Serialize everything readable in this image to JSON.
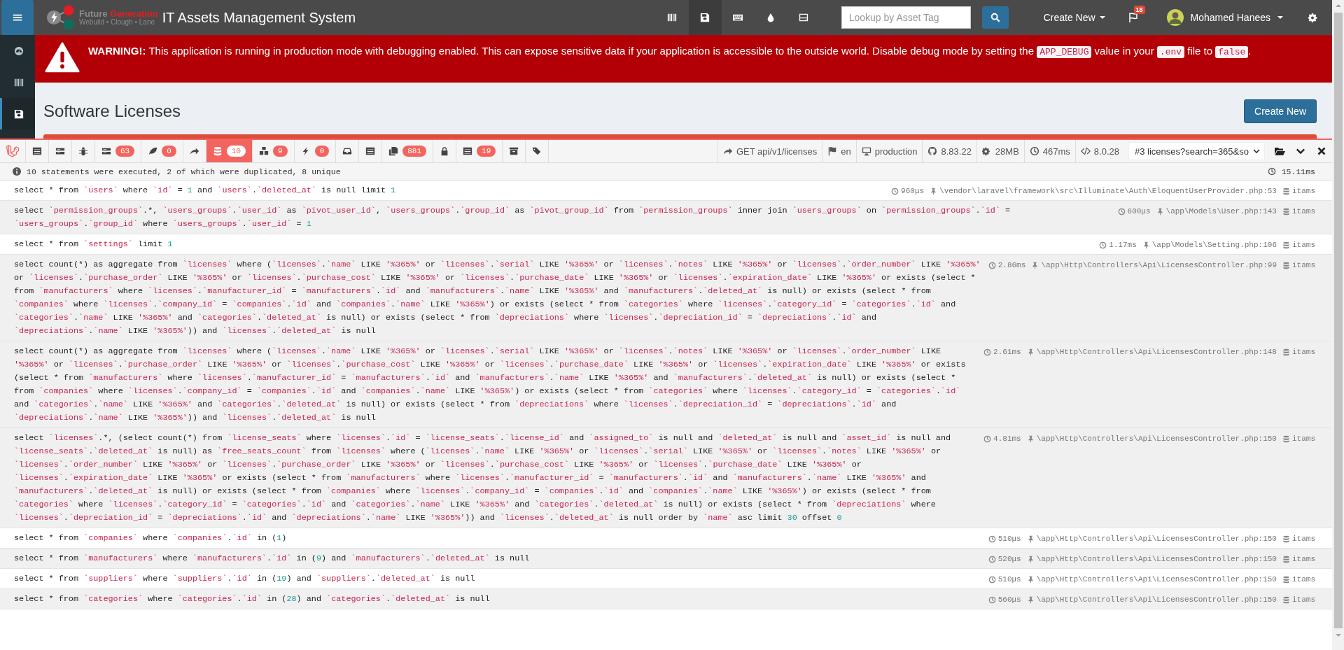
{
  "nav": {
    "logo": {
      "word_1": "Future",
      "word_2": "Generation",
      "tagline": "Webuild • Clough • Lane"
    },
    "title": "IT Assets Management System",
    "icons": [
      {
        "kind": "barcode",
        "selected": false
      },
      {
        "kind": "save",
        "selected": true
      },
      {
        "kind": "keyboard",
        "selected": false
      },
      {
        "kind": "drop",
        "selected": false
      },
      {
        "kind": "drive",
        "selected": false
      }
    ],
    "search": {
      "placeholder": "Lookup by Asset Tag"
    },
    "create_menu": "Create New",
    "flag_badge": "18",
    "user": "Mohamed Hanees"
  },
  "sidebar": {
    "items": [
      {
        "kind": "dashboard",
        "selected": false
      },
      {
        "kind": "barcode",
        "selected": false
      },
      {
        "kind": "save",
        "selected": true
      }
    ]
  },
  "warning": {
    "segments": [
      {
        "kind": "text",
        "text": "**WARNING!:** This application is running in production mode with debugging enabled. This can expose sensitive data if your application is accessible to the outside world. Disable debug mode by setting the "
      },
      {
        "kind": "code",
        "text": "APP_DEBUG"
      },
      {
        "kind": "text",
        "text": " value in your "
      },
      {
        "kind": "code",
        "text": ".env"
      },
      {
        "kind": "text",
        "text": " file to "
      },
      {
        "kind": "code",
        "text": "false"
      },
      {
        "kind": "text",
        "text": "."
      }
    ]
  },
  "page": {
    "title": "Software Licenses",
    "create_button": "Create New"
  },
  "debugbar": {
    "tabs": [
      {
        "kind": "list",
        "selected": false
      },
      {
        "kind": "bars",
        "selected": false
      },
      {
        "kind": "bug",
        "selected": false
      },
      {
        "kind": "bars",
        "badge": "63",
        "selected": false
      },
      {
        "kind": "leaf",
        "badge": "0",
        "selected": false
      },
      {
        "kind": "arrow",
        "selected": false
      },
      {
        "kind": "database",
        "badge": "10",
        "selected": true
      },
      {
        "kind": "cubes",
        "badge": "9",
        "selected": false
      },
      {
        "kind": "bolt",
        "badge": "0",
        "selected": false
      },
      {
        "kind": "inbox",
        "selected": false
      },
      {
        "kind": "list",
        "selected": false
      },
      {
        "kind": "pages",
        "badge": "881",
        "selected": false
      },
      {
        "kind": "lock",
        "selected": false
      },
      {
        "kind": "list",
        "badge": "19",
        "selected": false
      },
      {
        "kind": "archive",
        "selected": false
      },
      {
        "kind": "tags",
        "selected": false
      }
    ],
    "meta": [
      {
        "kind": "arrow",
        "text": "GET api/v1/licenses"
      },
      {
        "kind": "flag",
        "text": "en"
      },
      {
        "kind": "monitor",
        "text": "production"
      },
      {
        "kind": "github",
        "text": "8.83.22"
      },
      {
        "kind": "gears",
        "text": "28MB"
      },
      {
        "kind": "clock",
        "text": "467ms"
      },
      {
        "kind": "code",
        "text": "8.0.28"
      }
    ],
    "dataset": "#3 licenses?search=365&so",
    "summary": "10 statements were executed, 2 of which were duplicated, 8 unique",
    "total_time": "15.11ms",
    "statements": [
      {
        "sql": "select * from `users` where `id` = 1 and `users`.`deleted_at` is null limit 1",
        "duration": "960μs",
        "source": "\\vendor\\laravel\\framework\\src\\Illuminate\\Auth\\EloquentUserProvider.php:53",
        "connection": "itams",
        "highlighted": false
      },
      {
        "sql": "select `permission_groups`.*, `users_groups`.`user_id` as `pivot_user_id`, `users_groups`.`group_id` as `pivot_group_id` from `permission_groups` inner join `users_groups` on `permission_groups`.`id` = `users_groups`.`group_id` where `users_groups`.`user_id` = 1",
        "duration": "600μs",
        "source": "\\app\\Models\\User.php:143",
        "connection": "itams",
        "highlighted": true
      },
      {
        "sql": "select * from `settings` limit 1",
        "duration": "1.17ms",
        "source": "\\app\\Models\\Setting.php:106",
        "connection": "itams",
        "highlighted": false
      },
      {
        "sql": "select count(*) as aggregate from `licenses` where (`licenses`.`name` LIKE '%365%' or `licenses`.`serial` LIKE '%365%' or `licenses`.`notes` LIKE '%365%' or `licenses`.`order_number` LIKE '%365%' or `licenses`.`purchase_order` LIKE '%365%' or `licenses`.`purchase_cost` LIKE '%365%' or `licenses`.`purchase_date` LIKE '%365%' or `licenses`.`expiration_date` LIKE '%365%' or exists (select * from `manufacturers` where `licenses`.`manufacturer_id` = `manufacturers`.`id` and `manufacturers`.`name` LIKE '%365%' and `manufacturers`.`deleted_at` is null) or exists (select * from `companies` where `licenses`.`company_id` = `companies`.`id` and `companies`.`name` LIKE '%365%') or exists (select * from `categories` where `licenses`.`category_id` = `categories`.`id` and `categories`.`name` LIKE '%365%' and `categories`.`deleted_at` is null) or exists (select * from `depreciations` where `licenses`.`depreciation_id` = `depreciations`.`id` and `depreciations`.`name` LIKE '%365%')) and `licenses`.`deleted_at` is null",
        "duration": "2.86ms",
        "source": "\\app\\Http\\Controllers\\Api\\LicensesController.php:99",
        "connection": "itams",
        "highlighted": true
      },
      {
        "sql": "select count(*) as aggregate from `licenses` where (`licenses`.`name` LIKE '%365%' or `licenses`.`serial` LIKE '%365%' or `licenses`.`notes` LIKE '%365%' or `licenses`.`order_number` LIKE '%365%' or `licenses`.`purchase_order` LIKE '%365%' or `licenses`.`purchase_cost` LIKE '%365%' or `licenses`.`purchase_date` LIKE '%365%' or `licenses`.`expiration_date` LIKE '%365%' or exists (select * from `manufacturers` where `licenses`.`manufacturer_id` = `manufacturers`.`id` and `manufacturers`.`name` LIKE '%365%' and `manufacturers`.`deleted_at` is null) or exists (select * from `companies` where `licenses`.`company_id` = `companies`.`id` and `companies`.`name` LIKE '%365%') or exists (select * from `categories` where `licenses`.`category_id` = `categories`.`id` and `categories`.`name` LIKE '%365%' and `categories`.`deleted_at` is null) or exists (select * from `depreciations` where `licenses`.`depreciation_id` = `depreciations`.`id` and `depreciations`.`name` LIKE '%365%')) and `licenses`.`deleted_at` is null",
        "duration": "2.61ms",
        "source": "\\app\\Http\\Controllers\\Api\\LicensesController.php:148",
        "connection": "itams",
        "highlighted": true
      },
      {
        "sql": "select `licenses`.*, (select count(*) from `license_seats` where `licenses`.`id` = `license_seats`.`license_id` and `assigned_to` is null and `deleted_at` is null and `asset_id` is null and `license_seats`.`deleted_at` is null) as `free_seats_count` from `licenses` where (`licenses`.`name` LIKE '%365%' or `licenses`.`serial` LIKE '%365%' or `licenses`.`notes` LIKE '%365%' or `licenses`.`order_number` LIKE '%365%' or `licenses`.`purchase_order` LIKE '%365%' or `licenses`.`purchase_cost` LIKE '%365%' or `licenses`.`purchase_date` LIKE '%365%' or `licenses`.`expiration_date` LIKE '%365%' or exists (select * from `manufacturers` where `licenses`.`manufacturer_id` = `manufacturers`.`id` and `manufacturers`.`name` LIKE '%365%' and `manufacturers`.`deleted_at` is null) or exists (select * from `companies` where `licenses`.`company_id` = `companies`.`id` and `companies`.`name` LIKE '%365%') or exists (select * from `categories` where `licenses`.`category_id` = `categories`.`id` and `categories`.`name` LIKE '%365%' and `categories`.`deleted_at` is null) or exists (select * from `depreciations` where `licenses`.`depreciation_id` = `depreciations`.`id` and `depreciations`.`name` LIKE '%365%')) and `licenses`.`deleted_at` is null order by `name` asc limit 30 offset 0",
        "duration": "4.81ms",
        "source": "\\app\\Http\\Controllers\\Api\\LicensesController.php:150",
        "connection": "itams",
        "highlighted": true
      },
      {
        "sql": "select * from `companies` where `companies`.`id` in (1)",
        "duration": "510μs",
        "source": "\\app\\Http\\Controllers\\Api\\LicensesController.php:150",
        "connection": "itams",
        "highlighted": false
      },
      {
        "sql": "select * from `manufacturers` where `manufacturers`.`id` in (9) and `manufacturers`.`deleted_at` is null",
        "duration": "520μs",
        "source": "\\app\\Http\\Controllers\\Api\\LicensesController.php:150",
        "connection": "itams",
        "highlighted": true
      },
      {
        "sql": "select * from `suppliers` where `suppliers`.`id` in (19) and `suppliers`.`deleted_at` is null",
        "duration": "510μs",
        "source": "\\app\\Http\\Controllers\\Api\\LicensesController.php:150",
        "connection": "itams",
        "highlighted": false
      },
      {
        "sql": "select * from `categories` where `categories`.`id` in (28) and `categories`.`deleted_at` is null",
        "duration": "560μs",
        "source": "\\app\\Http\\Controllers\\Api\\LicensesController.php:150",
        "connection": "itams",
        "highlighted": true
      }
    ]
  }
}
